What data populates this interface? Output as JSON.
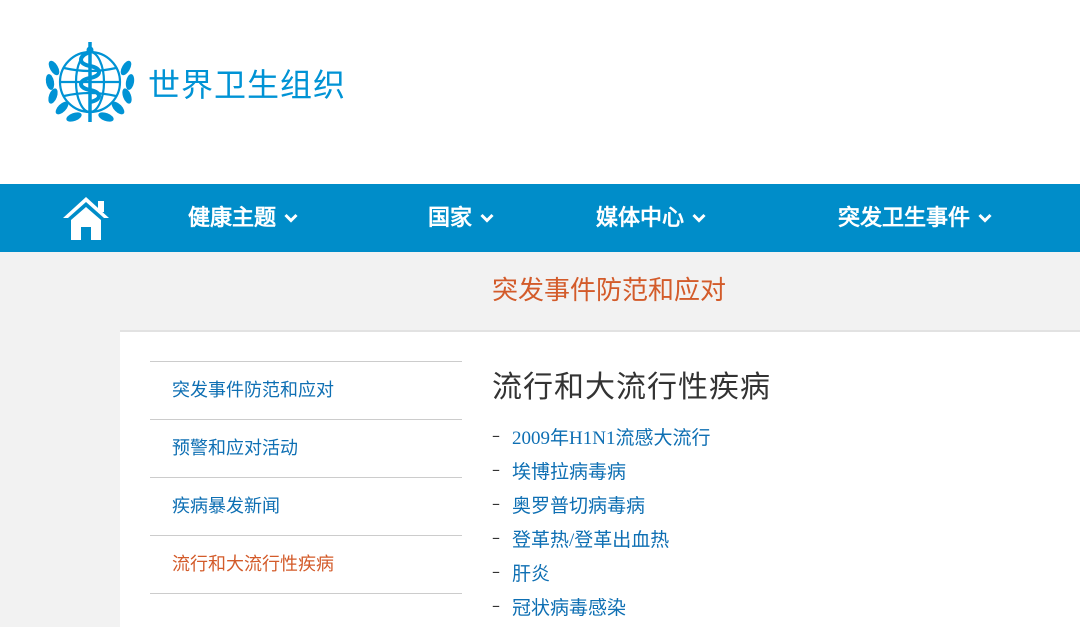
{
  "header": {
    "logo_text": "世界卫生组织",
    "logo_icon": "who-emblem-icon"
  },
  "nav": {
    "home_icon": "home-icon",
    "items": [
      {
        "label": "健康主题"
      },
      {
        "label": "国家"
      },
      {
        "label": "媒体中心"
      },
      {
        "label": "突发卫生事件"
      }
    ]
  },
  "section": {
    "title": "突发事件防范和应对"
  },
  "sidenav": {
    "items": [
      {
        "label": "突发事件防范和应对",
        "active": false
      },
      {
        "label": "预警和应对活动",
        "active": false
      },
      {
        "label": "疾病暴发新闻",
        "active": false
      },
      {
        "label": "流行和大流行性疾病",
        "active": true
      }
    ]
  },
  "main": {
    "title": "流行和大流行性疾病",
    "links": [
      {
        "label": "2009年H1N1流感大流行"
      },
      {
        "label": "埃博拉病毒病"
      },
      {
        "label": "奥罗普切病毒病"
      },
      {
        "label": "登革热/登革出血热"
      },
      {
        "label": "肝炎"
      },
      {
        "label": "冠状病毒感染"
      }
    ]
  },
  "colors": {
    "brand_blue": "#008dc9",
    "logo_blue": "#0093d5",
    "link_blue": "#0e6fb3",
    "accent_orange": "#d35b2a",
    "panel_gray": "#f2f2f2"
  }
}
